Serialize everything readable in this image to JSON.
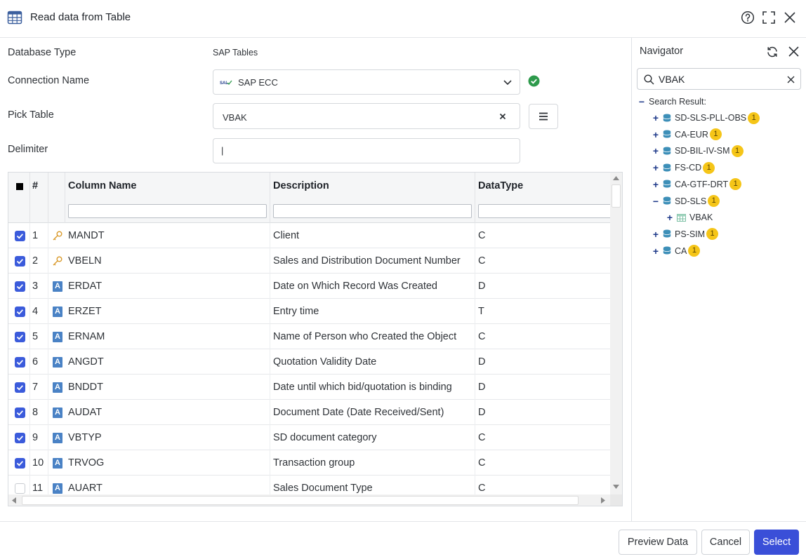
{
  "header": {
    "title": "Read data from Table",
    "icons": [
      "table-icon",
      "help-icon",
      "expand-icon",
      "close-icon"
    ]
  },
  "form": {
    "database_type_label": "Database Type",
    "database_type_value": "SAP Tables",
    "connection_name_label": "Connection Name",
    "connection_name_value": "SAP ECC",
    "pick_table_label": "Pick Table",
    "pick_table_value": "VBAK",
    "delimiter_label": "Delimiter",
    "delimiter_value": "|"
  },
  "grid": {
    "headers": {
      "index": "#",
      "column_name": "Column Name",
      "description": "Description",
      "datatype": "DataType"
    },
    "rows": [
      {
        "n": "1",
        "type": "key",
        "name": "MANDT",
        "desc": "Client",
        "dt": "C",
        "checked": true
      },
      {
        "n": "2",
        "type": "key",
        "name": "VBELN",
        "desc": "Sales and Distribution Document Number",
        "dt": "C",
        "checked": true
      },
      {
        "n": "3",
        "type": "A",
        "name": "ERDAT",
        "desc": "Date on Which Record Was Created",
        "dt": "D",
        "checked": true
      },
      {
        "n": "4",
        "type": "A",
        "name": "ERZET",
        "desc": "Entry time",
        "dt": "T",
        "checked": true
      },
      {
        "n": "5",
        "type": "A",
        "name": "ERNAM",
        "desc": "Name of Person who Created the Object",
        "dt": "C",
        "checked": true
      },
      {
        "n": "6",
        "type": "A",
        "name": "ANGDT",
        "desc": "Quotation Validity Date",
        "dt": "D",
        "checked": true
      },
      {
        "n": "7",
        "type": "A",
        "name": "BNDDT",
        "desc": "Date until which bid/quotation is binding",
        "dt": "D",
        "checked": true
      },
      {
        "n": "8",
        "type": "A",
        "name": "AUDAT",
        "desc": "Document Date (Date Received/Sent)",
        "dt": "D",
        "checked": true
      },
      {
        "n": "9",
        "type": "A",
        "name": "VBTYP",
        "desc": "SD document category",
        "dt": "C",
        "checked": true
      },
      {
        "n": "10",
        "type": "A",
        "name": "TRVOG",
        "desc": "Transaction group",
        "dt": "C",
        "checked": true
      },
      {
        "n": "11",
        "type": "A",
        "name": "AUART",
        "desc": "Sales Document Type",
        "dt": "C",
        "checked": false
      }
    ]
  },
  "navigator": {
    "title": "Navigator",
    "search_value": "VBAK",
    "root_label": "Search Result:",
    "nodes": [
      {
        "label": "SD-SLS-PLL-OBS",
        "count": "1"
      },
      {
        "label": "CA-EUR",
        "count": "1"
      },
      {
        "label": "SD-BIL-IV-SM",
        "count": "1"
      },
      {
        "label": "FS-CD",
        "count": "1"
      },
      {
        "label": "CA-GTF-DRT",
        "count": "1"
      },
      {
        "label": "SD-SLS",
        "count": "1",
        "expanded": true
      },
      {
        "label": "VBAK",
        "child": true
      },
      {
        "label": "PS-SIM",
        "count": "1"
      },
      {
        "label": "CA",
        "count": "1"
      }
    ]
  },
  "footer": {
    "preview_label": "Preview Data",
    "cancel_label": "Cancel",
    "select_label": "Select"
  },
  "colors": {
    "primary": "#3a4fd8",
    "success": "#2e9a4c",
    "badge": "#f5c518"
  }
}
